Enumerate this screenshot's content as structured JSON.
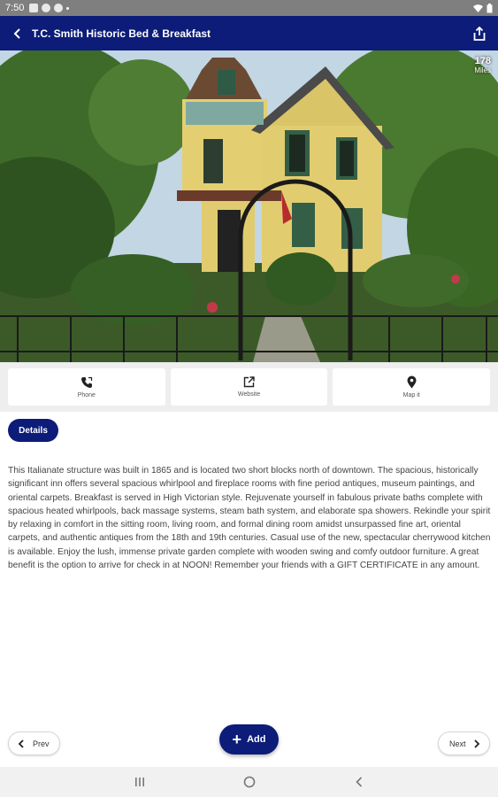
{
  "status_bar": {
    "time": "7:50"
  },
  "app_bar": {
    "title": "T.C. Smith Historic Bed & Breakfast"
  },
  "hero": {
    "distance_value": "178",
    "distance_unit": "Miles"
  },
  "actions": [
    {
      "label": "Phone",
      "icon": "phone-icon"
    },
    {
      "label": "Website",
      "icon": "external-link-icon"
    },
    {
      "label": "Map it",
      "icon": "map-pin-icon"
    }
  ],
  "details_label": "Details",
  "description": "This Italianate structure was built in 1865 and is located two short blocks north of downtown. The spacious, historically significant inn offers several spacious whirlpool and fireplace rooms with fine period antiques, museum paintings, and oriental carpets. Breakfast is served in High Victorian style. Rejuvenate yourself in fabulous private baths complete with spacious heated whirlpools, back massage systems, steam bath system, and elaborate spa showers. Rekindle your spirit by relaxing in comfort in the sitting room, living room, and formal dining room amidst unsurpassed fine art, oriental carpets, and authentic antiques from the 18th and 19th centuries. Casual use of the new, spectacular cherrywood kitchen is available. Enjoy the lush, immense private garden complete with wooden swing and comfy outdoor furniture.  A great benefit is the option to arrive for check in at NOON!   Remember your friends with a GIFT CERTIFICATE in any amount.",
  "footer": {
    "prev_label": "Prev",
    "add_label": "Add",
    "next_label": "Next"
  },
  "colors": {
    "primary": "#0c1c78",
    "status_bar": "#7f7f7f",
    "nav_bar": "#f1f1f1"
  }
}
